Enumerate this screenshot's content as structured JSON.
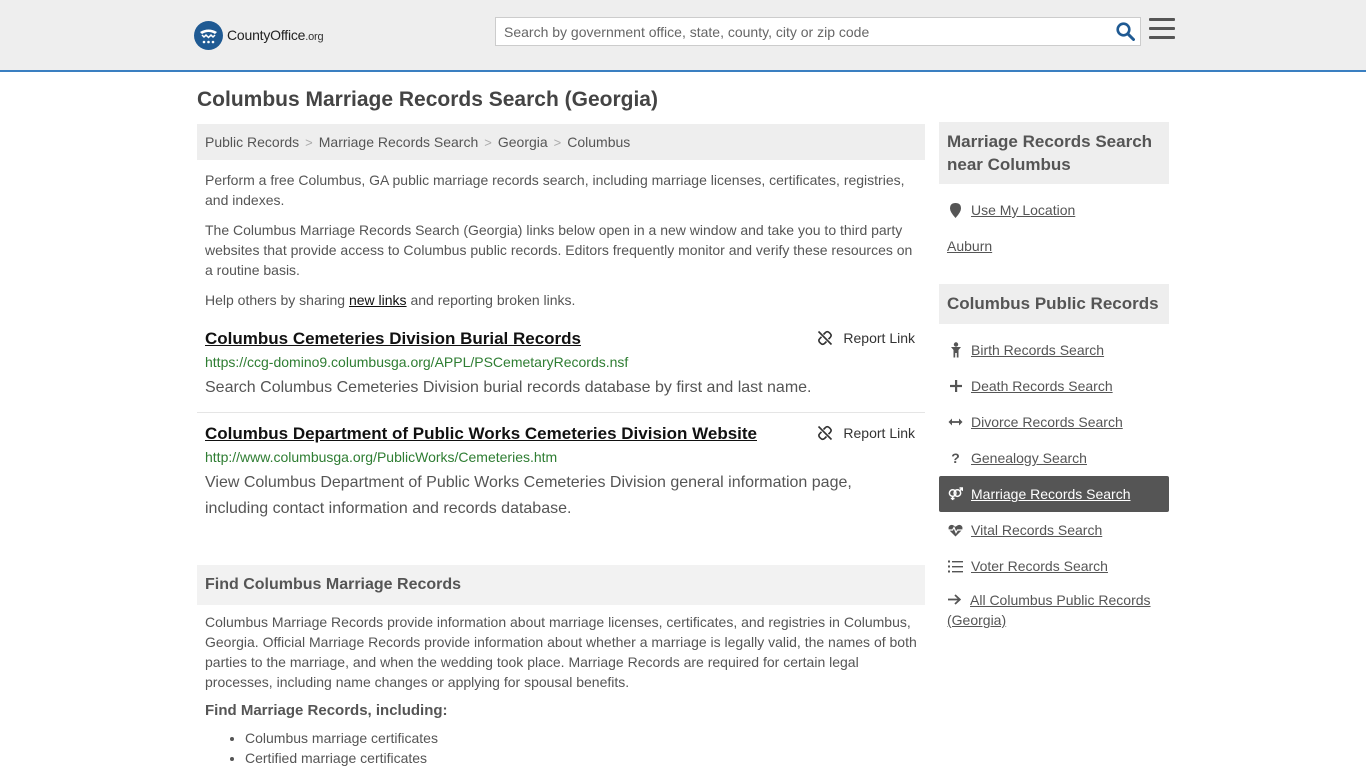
{
  "header": {
    "logo_text": "CountyOffice",
    "logo_suffix": ".org",
    "search_placeholder": "Search by government office, state, county, city or zip code"
  },
  "page_title": "Columbus Marriage Records Search (Georgia)",
  "breadcrumb": [
    "Public Records",
    "Marriage Records Search",
    "Georgia",
    "Columbus"
  ],
  "intro": {
    "p1": "Perform a free Columbus, GA public marriage records search, including marriage licenses, certificates, registries, and indexes.",
    "p2": "The Columbus Marriage Records Search (Georgia) links below open in a new window and take you to third party websites that provide access to Columbus public records. Editors frequently monitor and verify these resources on a routine basis.",
    "p3_before": "Help others by sharing ",
    "p3_link": "new links",
    "p3_after": " and reporting broken links."
  },
  "results": [
    {
      "title": "Columbus Cemeteries Division Burial Records",
      "url": "https://ccg-domino9.columbusga.org/APPL/PSCemetaryRecords.nsf",
      "description": "Search Columbus Cemeteries Division burial records database by first and last name.",
      "report_label": "Report Link"
    },
    {
      "title": "Columbus Department of Public Works Cemeteries Division Website",
      "url": "http://www.columbusga.org/PublicWorks/Cemeteries.htm",
      "description": "View Columbus Department of Public Works Cemeteries Division general information page, including contact information and records database.",
      "report_label": "Report Link"
    }
  ],
  "find_section": {
    "heading": "Find Columbus Marriage Records",
    "body": "Columbus Marriage Records provide information about marriage licenses, certificates, and registries in Columbus, Georgia. Official Marriage Records provide information about whether a marriage is legally valid, the names of both parties to the marriage, and when the wedding took place. Marriage Records are required for certain legal processes, including name changes or applying for spousal benefits.",
    "subheading": "Find Marriage Records, including:",
    "bullets": [
      "Columbus marriage certificates",
      "Certified marriage certificates"
    ]
  },
  "sidebar": {
    "near_heading": "Marriage Records Search near Columbus",
    "use_location": "Use My Location",
    "nearby": [
      "Auburn"
    ],
    "public_heading": "Columbus Public Records",
    "items": [
      {
        "label": "Birth Records Search",
        "icon": "child-icon"
      },
      {
        "label": "Death Records Search",
        "icon": "cross-icon"
      },
      {
        "label": "Divorce Records Search",
        "icon": "arrows-horizontal-icon"
      },
      {
        "label": "Genealogy Search",
        "icon": "question-icon"
      },
      {
        "label": "Marriage Records Search",
        "icon": "venus-mars-icon",
        "active": true
      },
      {
        "label": "Vital Records Search",
        "icon": "heartbeat-icon"
      },
      {
        "label": "Voter Records Search",
        "icon": "list-numbered-icon"
      }
    ],
    "all_link": "All Columbus Public Records (Georgia)"
  },
  "colors": {
    "accent_blue": "#3a7fc1",
    "logo_blue": "#1f5a93",
    "url_green": "#2e7d32",
    "active_bg": "#555555"
  }
}
